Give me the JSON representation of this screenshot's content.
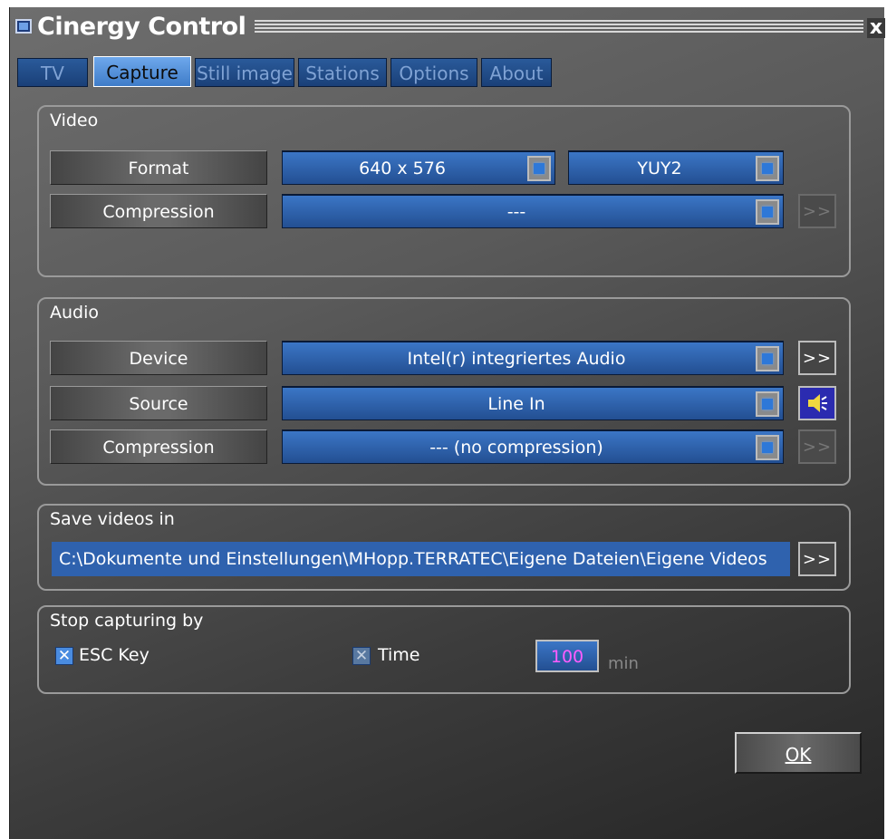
{
  "window": {
    "title": "Cinergy Control",
    "close_glyph": "x"
  },
  "tabs": [
    {
      "label": "TV",
      "active": false
    },
    {
      "label": "Capture",
      "active": true
    },
    {
      "label": "Still image",
      "active": false
    },
    {
      "label": "Stations",
      "active": false
    },
    {
      "label": "Options",
      "active": false
    },
    {
      "label": "About",
      "active": false
    }
  ],
  "video": {
    "title": "Video",
    "format_label": "Format",
    "format_value": "640 x 576",
    "colorspace_value": "YUY2",
    "compression_label": "Compression",
    "compression_value": "---",
    "more_label": ">>"
  },
  "audio": {
    "title": "Audio",
    "device_label": "Device",
    "device_value": "Intel(r) integriertes Audio",
    "source_label": "Source",
    "source_value": "Line In",
    "compression_label": "Compression",
    "compression_value": "--- (no compression)",
    "more_label": ">>",
    "speaker_icon": "speaker-icon"
  },
  "save": {
    "title": "Save videos in",
    "path": "C:\\Dokumente und Einstellungen\\MHopp.TERRATEC\\Eigene Dateien\\Eigene Videos",
    "browse_label": ">>"
  },
  "stop": {
    "title": "Stop capturing by",
    "esc_label": "ESC Key",
    "esc_checked": true,
    "time_label": "Time",
    "time_checked": true,
    "time_value": "100",
    "time_unit": "min"
  },
  "ok_label": "OK",
  "colors": {
    "accent": "#3b76c6",
    "active_tab": "#6ea8ec",
    "time_text": "#ff5cff"
  }
}
